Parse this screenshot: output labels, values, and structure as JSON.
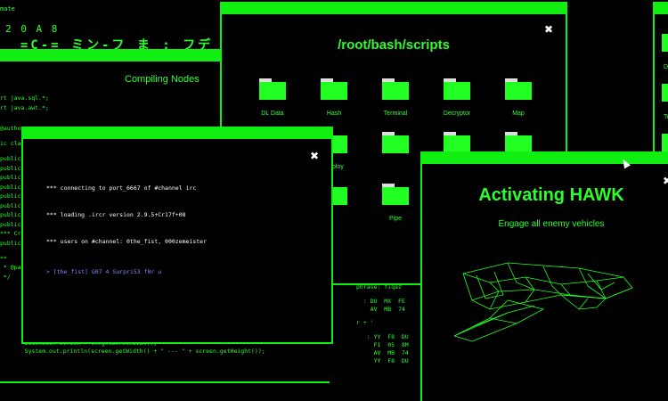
{
  "topstrip": {
    "line1": "mate",
    "line2": "          2 0 A 8",
    "line3": "_  =C-=  ミン-フ  ま  :  フデフ:  ま  :  :  |  2"
  },
  "code_window": {
    "title": "Compiling Nodes",
    "lines": [
      "rt java.sql.*;",
      "rt java.awt.*;",
      "",
      "",
      "@author",
      "",
      "ic clas",
      "",
      "public",
      "public",
      "public",
      "public",
      "public",
      "public",
      "public",
      "public",
      "*** Cr",
      "public",
      "",
      "**",
      " * @pa",
      " */",
      "public",
      "    //",
      "",
      "    bo",
      "    in",
      "    fr",
      "    Sys",
      " + App"
    ]
  },
  "scripts_window": {
    "title": "/root/bash/scripts",
    "close": "✖",
    "folders": [
      "DL Data",
      "Hash",
      "Terminal",
      "Decryptor",
      "Map",
      "",
      "Deploy",
      "",
      "",
      "",
      "Root",
      "",
      "Pipe"
    ]
  },
  "irc_window": {
    "close": "✖",
    "lines": [
      "*** connecting to port_6667 of #channel irc",
      "*** loading .ircr version 2.9.5+Cr17f+08",
      "*** users on #channel: 0the_fist, 000zemeister"
    ],
    "prompt": "> [the_fist] G07 4 Surpri53 f0r u"
  },
  "lower_terminal": {
    "lines": [
      "",
      "",
      "",
      "",
      "",
      "",
      "",
      "",
      "    Toolkit tk = Toolkit.getDefaultToolkit();",
      "    Dimension screen = tk.getScreenSize();",
      "    System.out.println(screen.getWidth() + \" --- \" + screen.getHeight());"
    ]
  },
  "hex_window": {
    "lines": [
      "phrase: fiqaz",
      "",
      "  : DU  MX  FE",
      "    AV  MB  74",
      "",
      "r + '",
      "",
      "   : YY  F8  DU",
      "     F1  05  8M",
      "     AV  MB  74",
      "     YY  F8  DU"
    ]
  },
  "hawk_window": {
    "title": "Activating HAWK",
    "subtitle": "Engage all enemy vehicles",
    "close": "✖"
  },
  "right_window": {
    "labels": [
      "D",
      "Te",
      ""
    ]
  }
}
